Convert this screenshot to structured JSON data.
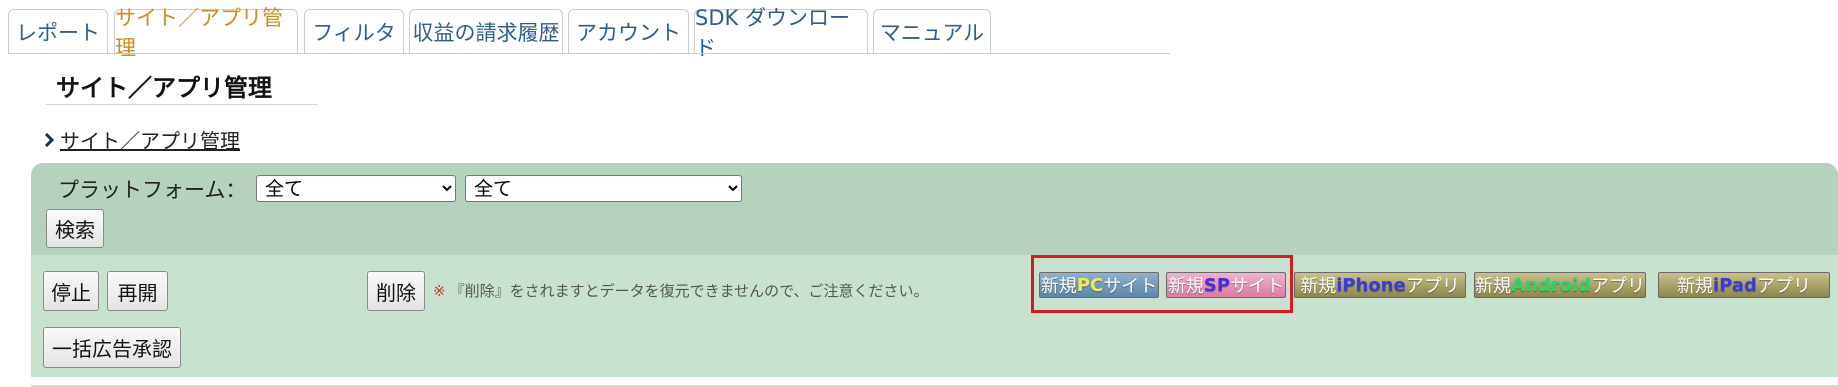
{
  "tabs": [
    {
      "label": "レポート",
      "active": false
    },
    {
      "label": "サイト／アプリ管理",
      "active": true
    },
    {
      "label": "フィルタ",
      "active": false
    },
    {
      "label": "収益の請求履歴",
      "active": false
    },
    {
      "label": "アカウント",
      "active": false
    },
    {
      "label": "SDK ダウンロード",
      "active": false
    },
    {
      "label": "マニュアル",
      "active": false
    }
  ],
  "page": {
    "title": "サイト／アプリ管理",
    "breadcrumb": "サイト／アプリ管理"
  },
  "filter": {
    "platform_label": "プラットフォーム：",
    "select1_value": "全て",
    "select2_value": "全て",
    "search_label": "検索"
  },
  "actions": {
    "stop_label": "停止",
    "resume_label": "再開",
    "delete_label": "削除",
    "bulk_approve_label": "一括広告承認",
    "warning_mark": "※",
    "warning_text": "『削除』をされますとデータを復元できませんので、ご注意ください。"
  },
  "new_buttons": [
    {
      "prefix": "新規",
      "highlight": "PC",
      "suffix": "サイト"
    },
    {
      "prefix": "新規",
      "highlight": "SP",
      "suffix": "サイト"
    },
    {
      "prefix": "新規",
      "highlight": "iPhone",
      "suffix": "アプリ"
    },
    {
      "prefix": "新規",
      "highlight": "Android",
      "suffix": "アプリ"
    },
    {
      "prefix": "新規",
      "highlight": "iPad",
      "suffix": "アプリ"
    }
  ],
  "colors": {
    "active_tab": "#d08a1e",
    "tab_text": "#2f5d8c",
    "filter_bg": "#b6d1bd",
    "action_bg": "#c9e2cf",
    "highlight_border": "#d41c24",
    "warning_mark": "#e0332b"
  },
  "icons": {
    "breadcrumb_chevron": "chevron-right-icon",
    "select_dropdown": "chevron-down-icon"
  }
}
